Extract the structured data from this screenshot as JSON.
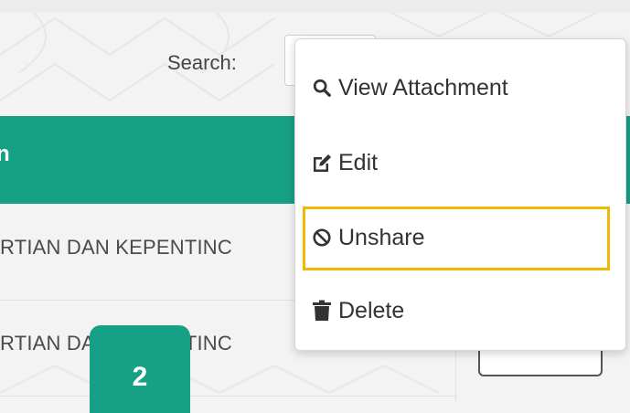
{
  "search": {
    "label": "Search:",
    "value": "",
    "placeholder": ""
  },
  "table": {
    "header_partial": "n",
    "rows": [
      {
        "text_partial": "RTIAN DAN KEPENTINC"
      },
      {
        "text_partial": "RTIAN DAN KEPENTINC"
      }
    ]
  },
  "dropdown": {
    "items": [
      {
        "label": "View Attachment",
        "icon": "search-icon"
      },
      {
        "label": "Edit",
        "icon": "edit-icon"
      },
      {
        "label": "Unshare",
        "icon": "ban-icon",
        "highlighted": true
      },
      {
        "label": "Delete",
        "icon": "trash-icon"
      }
    ]
  },
  "step_badge": {
    "label": "2"
  },
  "colors": {
    "accent": "#16a085",
    "highlight": "#f2b705",
    "background": "#f3f3f3"
  }
}
